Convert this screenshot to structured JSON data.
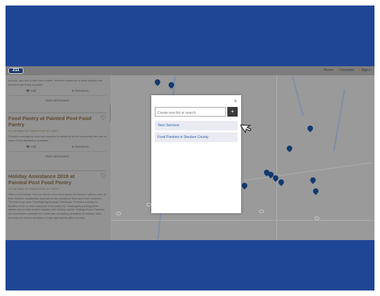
{
  "header": {
    "logo": "211",
    "links": [
      {
        "icon": "home-icon",
        "label": "Home"
      },
      {
        "icon": "heart-icon",
        "label": "Favorites"
      },
      {
        "icon": "signin-icon",
        "label": "Sign in"
      }
    ]
  },
  "results": [
    {
      "title": "",
      "address": "",
      "description": "seniors, who live in their own homes. Includes donations of adult diapers and personal grooming supplies.",
      "actions": {
        "call": "Call",
        "directions": "Directions"
      },
      "more": "More Information"
    },
    {
      "title": "Food Pantry at Painted Post Food Pantry",
      "address": "221 W Water St, Painted Post, NY 14870",
      "description": "Provides emergency food and supplies to residents of the community who are in need. Food distribution available.",
      "actions": {
        "call": "Call",
        "directions": "Directions"
      },
      "more": "More Information"
    },
    {
      "title": "Holiday Assistance 2019 at Painted Post Food Pantry",
      "address": "221 W Water St, Painted Post, NY 14870",
      "description": "Offers a Christmas Tree for clients of the food pantry to choose a gift for each of their children. Availability depends on the donations that have been received. The tree is up from Thanksgiving through Christmas. Provides a turkey to families of six or more using the food pantry for Thanksgiving during those weeks and to help smaller families with Holiday meals. Holiday hours. Families are sometimes available for Christmas. Accepting donations of turkeys, food and toys as well as donations of age appropriate gifts and toys.",
      "actions": {
        "call": "",
        "directions": ""
      },
      "more": ""
    }
  ],
  "modal": {
    "close": "×",
    "input_placeholder": "Create new list or search",
    "add_button": "+",
    "lists": [
      "Teen Services",
      "Food Pantries in Steuben County"
    ]
  },
  "colors": {
    "frame": "#1f4595",
    "overlay": "#8d8d8d",
    "link_text": "#2b5ea8",
    "pin": "#123a6f"
  }
}
